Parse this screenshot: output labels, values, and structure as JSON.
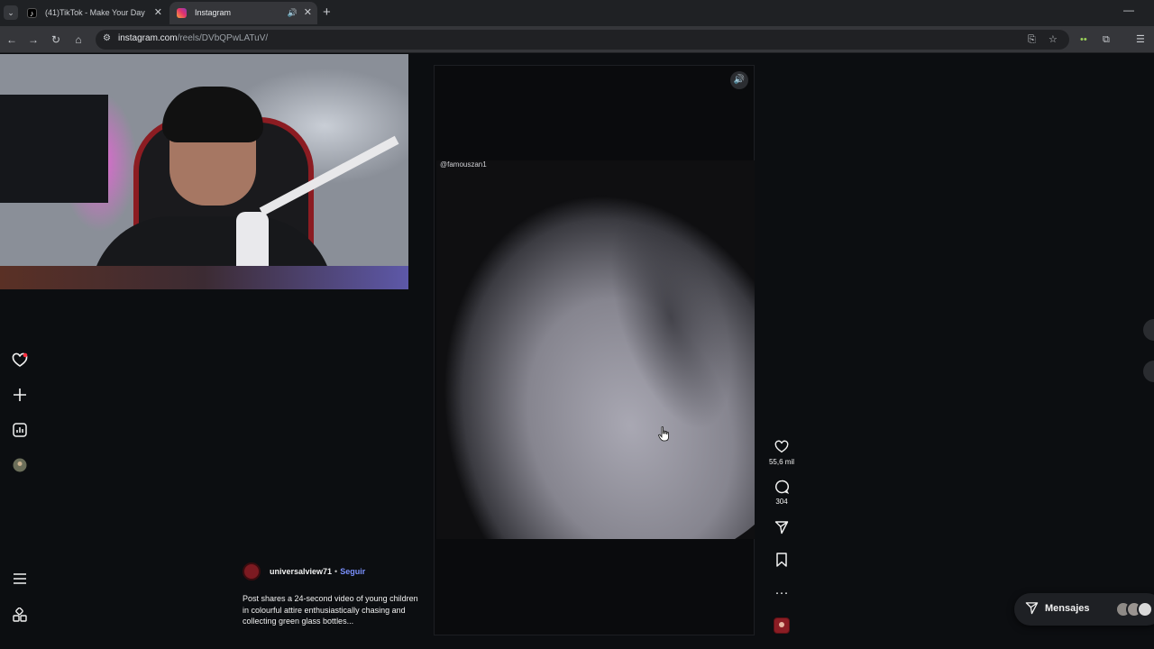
{
  "browser": {
    "tabs": [
      {
        "title": "(41)TikTok - Make Your Day",
        "active": false
      },
      {
        "title": "Instagram",
        "active": true
      }
    ],
    "url_host": "instagram.com",
    "url_path": "/reels/DVbQPwLATuV/",
    "icons": {
      "tab_list": "chevron-down-icon",
      "close": "close-icon",
      "mute": "speaker-icon",
      "new_tab": "plus-icon",
      "back": "arrow-left-icon",
      "forward": "arrow-right-icon",
      "reload": "reload-icon",
      "home": "home-icon"
    }
  },
  "sidebar": {
    "items": [
      {
        "name": "instagram-logo-icon"
      },
      {
        "name": "notifications-heart-icon"
      },
      {
        "name": "create-plus-icon"
      },
      {
        "name": "dashboard-icon"
      },
      {
        "name": "profile-avatar"
      },
      {
        "name": "menu-icon"
      },
      {
        "name": "more-apps-icon"
      }
    ]
  },
  "reel": {
    "watermark_handle": "@famouszan1",
    "likes": "55,6 mil",
    "comments": "304",
    "author": "universalview71",
    "separator": "•",
    "follow_label": "Seguir",
    "caption": "Post shares a 24-second video of young children in colourful attire enthusiastically chasing and collecting green glass bottles..."
  },
  "messages": {
    "label": "Mensajes"
  },
  "colors": {
    "accent_follow": "#7b91ff",
    "notification_dot": "#ff3040",
    "page_bg": "#0c0e11"
  }
}
